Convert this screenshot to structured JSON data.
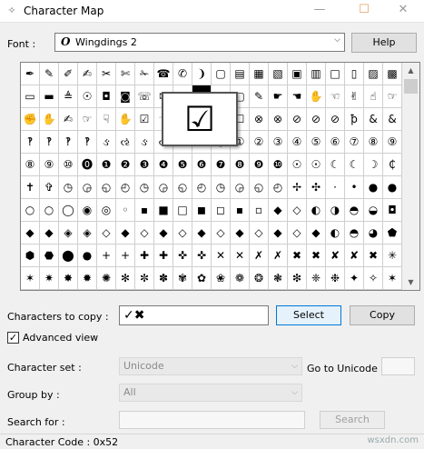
{
  "window": {
    "title": "Character Map",
    "minimize": "—",
    "maximize": "☐",
    "close": "✕"
  },
  "font": {
    "label": "Font :",
    "value": "Wingdings 2",
    "icon_glyph": "O",
    "help_label": "Help"
  },
  "grid": {
    "rows": [
      [
        "✒",
        "✎",
        "✐",
        "✍",
        "✂",
        "✄",
        "✁",
        "☎",
        "✆",
        "❩",
        "▢",
        "▤",
        "▦",
        "▧",
        "▣",
        "▥",
        "□",
        "▯",
        "▨",
        "▩"
      ],
      [
        "▭",
        "▬",
        "≜",
        "☉",
        "◘",
        "◙",
        "☏",
        "✉",
        "✈",
        "☑",
        "☒",
        "▢",
        "✎",
        "☛",
        "☚",
        "✋",
        "☜",
        "✌",
        "☝",
        "☞"
      ],
      [
        "✊",
        "✋",
        "✍",
        "☞",
        "☟",
        "✋",
        "☑",
        "☜",
        "☞",
        "☝",
        "☒",
        "☐",
        "⊗",
        "⊗",
        "⊘",
        "⊘",
        "⊘",
        "ꝥ",
        "&",
        "&"
      ],
      [
        "‽",
        "‽",
        "‽",
        "‽",
        "ઙ",
        "ઌ",
        "ઙ",
        "ઌ",
        "ઙ",
        "ઌ",
        "⓪",
        "①",
        "②",
        "③",
        "④",
        "⑤",
        "⑥",
        "⑦",
        "⑧",
        "⑨"
      ],
      [
        "⑧",
        "⑨",
        "⑩",
        "⓿",
        "❶",
        "❷",
        "❸",
        "❹",
        "❺",
        "❻",
        "❼",
        "❽",
        "❾",
        "❿",
        "☉",
        "☉",
        "☾",
        "☾",
        "☽",
        "₵"
      ],
      [
        "✝",
        "✞",
        "◷",
        "◶",
        "◵",
        "◴",
        "◷",
        "◶",
        "◵",
        "◴",
        "◷",
        "◶",
        "◵",
        "◴",
        "✢",
        "✣",
        "·",
        "•",
        "●",
        "●"
      ],
      [
        "○",
        "○",
        "◯",
        "◉",
        "◎",
        "◦",
        "▪",
        "■",
        "□",
        "◼",
        "◻",
        "▪",
        "▫",
        "◆",
        "◇",
        "◐",
        "◑",
        "◓",
        "◒",
        "◘"
      ],
      [
        "◆",
        "◆",
        "◈",
        "◈",
        "◇",
        "◆",
        "◇",
        "◆",
        "◇",
        "◆",
        "◇",
        "◆",
        "◇",
        "◆",
        "◇",
        "◆",
        "◐",
        "◓",
        "◕",
        "⬟"
      ],
      [
        "⬢",
        "⬣",
        "⬤",
        "●",
        "+",
        "+",
        "✚",
        "✚",
        "✜",
        "✜",
        "✕",
        "✕",
        "✗",
        "✗",
        "✖",
        "✖",
        "✘",
        "✘",
        "✖",
        "✳"
      ],
      [
        "✶",
        "✷",
        "✸",
        "✹",
        "✺",
        "✻",
        "✼",
        "✽",
        "✾",
        "✿",
        "❀",
        "❁",
        "❂",
        "❃",
        "❇",
        "❈",
        "❉",
        "✦",
        "✧",
        "✶"
      ]
    ],
    "selected_row": 1,
    "selected_col": 9,
    "zoom_char": "☑"
  },
  "copy": {
    "label": "Characters to copy :",
    "value": "✓✖",
    "select_label": "Select",
    "copy_label": "Copy"
  },
  "advanced": {
    "label": "Advanced view",
    "check": "✓"
  },
  "charset": {
    "label": "Character set :",
    "value": "Unicode",
    "goto_label": "Go to Unicode :",
    "goto_value": ""
  },
  "groupby": {
    "label": "Group by :",
    "value": "All"
  },
  "search": {
    "label": "Search for :",
    "value": "",
    "button_label": "Search"
  },
  "status": {
    "text": "Character Code : 0x52",
    "watermark": "wsxdn.com"
  }
}
